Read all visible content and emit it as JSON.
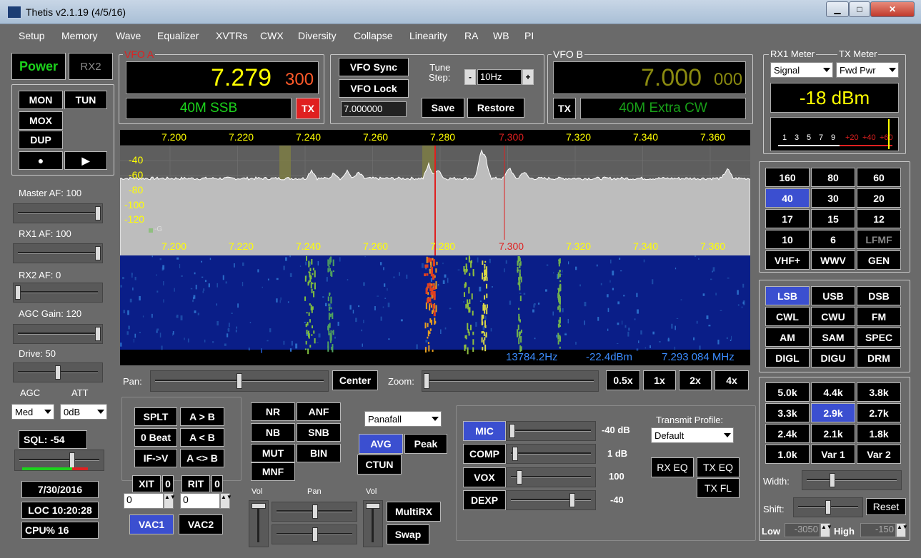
{
  "window": {
    "title": "Thetis v2.1.19 (4/5/16)",
    "minimize": "▁",
    "maximize": "□",
    "close": "✕"
  },
  "menu": [
    "Setup",
    "Memory",
    "Wave",
    "Equalizer",
    "XVTRs",
    "CWX",
    "Diversity",
    "Collapse",
    "Linearity",
    "RA",
    "WB",
    "PI"
  ],
  "left": {
    "power": "Power",
    "rx2": "RX2",
    "mon": "MON",
    "tun": "TUN",
    "mox": "MOX",
    "dup": "DUP",
    "rec": "●",
    "play": "▶",
    "master_af_label": "Master AF:  100",
    "rx1_af_label": "RX1 AF:  100",
    "rx2_af_label": "RX2 AF:  0",
    "agc_gain_label": "AGC Gain:  120",
    "drive_label": "Drive:  50",
    "agc_label": "AGC",
    "att_label": "ATT",
    "agc_value": "Med",
    "att_value": "0dB",
    "sql_label": "SQL:  -54",
    "date": "7/30/2016",
    "loc_time": "LOC 10:20:28",
    "cpu": "CPU%  16"
  },
  "vfo_a": {
    "label": "VFO A",
    "freq_main": "7.279",
    "freq_sub": "300",
    "band_mode": "40M SSB",
    "tx": "TX"
  },
  "vfo_controls": {
    "vfo_sync": "VFO Sync",
    "vfo_lock": "VFO Lock",
    "tune_step_label": "Tune\nStep:",
    "minus": "-",
    "plus": "+",
    "tune_step": "10Hz",
    "freq_entry": "7.000000",
    "save": "Save",
    "restore": "Restore"
  },
  "vfo_b": {
    "label": "VFO B",
    "freq_main": "7.000",
    "freq_sub": "000",
    "band_mode": "40M Extra CW",
    "tx": "TX"
  },
  "meter": {
    "rx1_meter_label": "RX1 Meter",
    "tx_meter_label": "TX Meter",
    "rx1_meter_value": "Signal",
    "tx_meter_value": "Fwd Pwr",
    "reading": "-18 dBm",
    "scale": [
      "1",
      "3",
      "5",
      "7",
      "9",
      "+20",
      "+40",
      "+60"
    ]
  },
  "spectrum": {
    "freq_ticks": [
      "7.200",
      "7.220",
      "7.240",
      "7.260",
      "7.280",
      "7.300",
      "7.320",
      "7.340",
      "7.360"
    ],
    "db_ticks": [
      "-40",
      "-60",
      "-80",
      "-100",
      "-120"
    ],
    "agc_marker": "-G",
    "status_offset": "13784.2Hz",
    "status_dbm": "-22.4dBm",
    "status_freq": "7.293 084 MHz"
  },
  "pan_zoom": {
    "pan_label": "Pan:",
    "center": "Center",
    "zoom_label": "Zoom:",
    "z05": "0.5x",
    "z1": "1x",
    "z2": "2x",
    "z4": "4x"
  },
  "bands": [
    "160",
    "80",
    "60",
    "40",
    "30",
    "20",
    "17",
    "15",
    "12",
    "10",
    "6",
    "LFMF",
    "VHF+",
    "WWV",
    "GEN"
  ],
  "modes": [
    "LSB",
    "USB",
    "DSB",
    "CWL",
    "CWU",
    "FM",
    "AM",
    "SAM",
    "SPEC",
    "DIGL",
    "DIGU",
    "DRM"
  ],
  "filters": [
    "5.0k",
    "4.4k",
    "3.8k",
    "3.3k",
    "2.9k",
    "2.7k",
    "2.4k",
    "2.1k",
    "1.8k",
    "1.0k",
    "Var 1",
    "Var 2"
  ],
  "filter_controls": {
    "width_label": "Width:",
    "shift_label": "Shift:",
    "reset": "Reset",
    "low_label": "Low",
    "low_value": "-3050",
    "high_label": "High",
    "high_value": "-150"
  },
  "split": {
    "split": "SPLT",
    "a_to_b": "A > B",
    "zero_beat": "0 Beat",
    "a_from_b": "A < B",
    "if_v": "IF->V",
    "a_swap_b": "A <> B",
    "xit": "XIT",
    "xit_val": "0",
    "rit": "RIT",
    "rit_val": "0",
    "xit_offset": "0",
    "rit_offset": "0",
    "vac1": "VAC1",
    "vac2": "VAC2"
  },
  "dsp": {
    "nr": "NR",
    "anf": "ANF",
    "nb": "NB",
    "snb": "SNB",
    "mut": "MUT",
    "bin": "BIN",
    "mnf": "MNF"
  },
  "display": {
    "mode": "Panafall",
    "avg": "AVG",
    "peak": "Peak",
    "ctun": "CTUN"
  },
  "mix": {
    "vol1": "Vol",
    "pan": "Pan",
    "vol2": "Vol",
    "multirx": "MultiRX",
    "swap": "Swap"
  },
  "tx": {
    "mic": "MIC",
    "mic_val": "-40 dB",
    "comp": "COMP",
    "comp_val": "1 dB",
    "vox": "VOX",
    "vox_val": "100",
    "dexp": "DEXP",
    "dexp_val": "-40",
    "profile_label": "Transmit Profile:",
    "profile": "Default",
    "rx_eq": "RX EQ",
    "tx_eq": "TX EQ",
    "tx_fl": "TX FL"
  },
  "colors": {
    "accent_blue": "#3b4fd0",
    "freq_yellow": "#ffff00",
    "vfo_green": "#1cd31c",
    "tx_red": "#e02020",
    "status_blue": "#3b8cff"
  }
}
